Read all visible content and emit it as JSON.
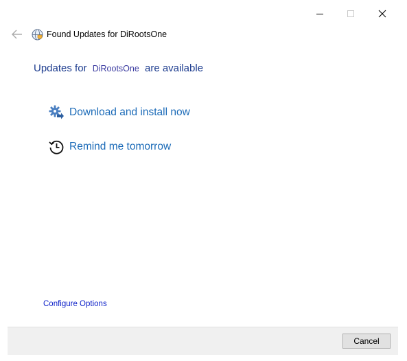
{
  "window": {
    "title": "Found Updates for DiRootsOne"
  },
  "caption_buttons": {
    "minimize_icon": "minimize-icon",
    "maximize_icon": "maximize-icon",
    "close_icon": "close-icon"
  },
  "heading": {
    "prefix": "Updates for",
    "product": "DiRootsOne",
    "suffix": "are available"
  },
  "commands": {
    "download_label": "Download and install now",
    "download_icon": "gear-arrow-icon",
    "remind_label": "Remind me tomorrow",
    "remind_icon": "history-clock-icon"
  },
  "configure_label": "Configure Options",
  "footer": {
    "cancel_label": "Cancel"
  },
  "colors": {
    "heading": "#1e3d8f",
    "command_link": "#1c6bb8",
    "configure_link": "#0a1ec8",
    "footer_bg": "#f0f0f0"
  }
}
